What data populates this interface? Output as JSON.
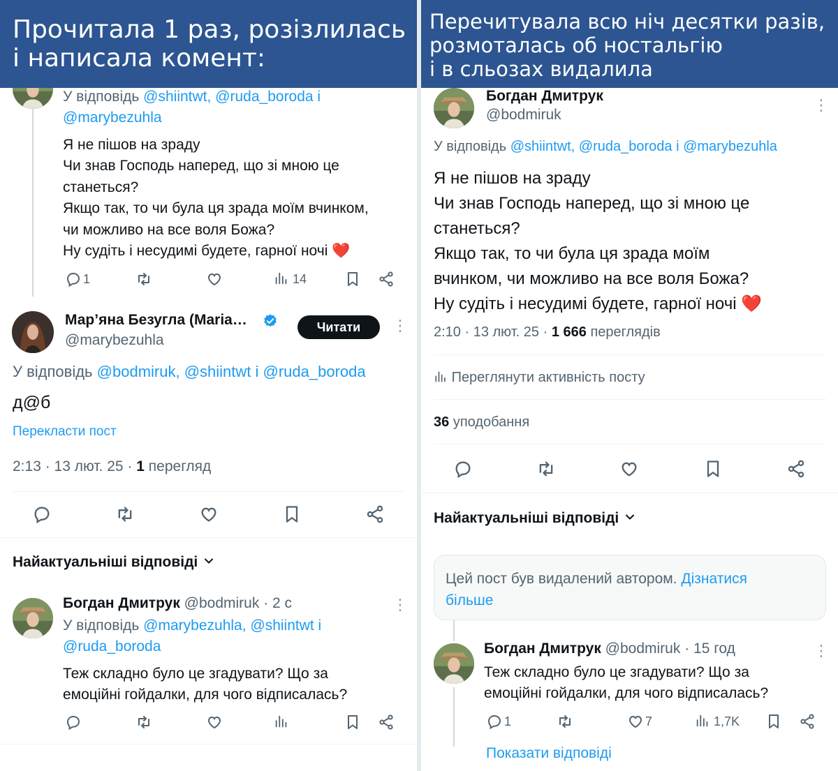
{
  "left": {
    "banner": [
      "Прочитала 1 раз, розізлилась",
      "і написала комент:"
    ],
    "tweet1": {
      "reply_to_line1_prefix": "У відповідь",
      "reply_to_line1_links": "@shiintwt, @ruda_boroda і",
      "reply_to_line2": "@marybezuhla",
      "text": [
        "Я не пішов на зраду",
        "Чи знав Господь наперед, що зі мною це",
        "станеться?",
        "Якщо так, то чи була ця зрада моїм вчинком,",
        "чи можливо на все воля Божа?",
        "Ну судіть і несудимі будете, гарної ночі"
      ],
      "heart_emoji": "❤️",
      "replies": "1",
      "views": "14"
    },
    "tweet2": {
      "name": "Мар’яна Безугла (Maria…",
      "handle": "@marybezuhla",
      "follow_label": "Читати",
      "reply_prefix": "У відповідь",
      "reply_links": "@bodmiruk, @shiintwt і @ruda_boroda",
      "text": "д@б",
      "translate": "Перекласти пост",
      "time": "2:13 · 13 лют. 25 ·",
      "views_num": "1",
      "views_label": "перегляд"
    },
    "replies_header": "Найактуальніші відповіді",
    "tweet3": {
      "name": "Богдан Дмитрук",
      "handle": "@bodmiruk · 2 с",
      "reply_prefix": "У відповідь",
      "reply_links_line1": "@marybezuhla, @shiintwt і",
      "reply_links_line2": "@ruda_boroda",
      "text": [
        "Теж складно було це згадувати? Що за",
        "емоційні гойдалки, для чого відписалась?"
      ]
    }
  },
  "right": {
    "banner": [
      "Перечитувала всю ніч десятки разів,",
      "розмоталась об ностальгію",
      "і в сльозах видалила"
    ],
    "main": {
      "name": "Богдан Дмитрук",
      "handle": "@bodmiruk",
      "reply_prefix": "У відповідь",
      "reply_links": "@shiintwt, @ruda_boroda і @marybezuhla",
      "text": [
        "Я не пішов на зраду",
        "Чи знав Господь наперед, що зі мною це",
        "станеться?",
        "Якщо так, то чи була ця зрада моїм",
        "вчинком, чи можливо на все воля Божа?",
        "Ну судіть і несудимі будете, гарної ночі"
      ],
      "heart_emoji": "❤️",
      "time": "2:10 · 13 лют. 25 ·",
      "views_num": "1 666",
      "views_label": "переглядів",
      "activity": "Переглянути активність посту",
      "likes_num": "36",
      "likes_label": "уподобання"
    },
    "replies_header": "Найактуальніші відповіді",
    "deleted": {
      "text": "Цей пост був видалений автором.",
      "link_line1": "Дізнатися",
      "link_line2": "більше"
    },
    "reply": {
      "name": "Богдан Дмитрук",
      "handle": "@bodmiruk · 15 год",
      "text": [
        "Теж складно було це згадувати? Що за",
        "емоційні гойдалки, для чого відписалась?"
      ],
      "replies": "1",
      "likes": "7",
      "views": "1,7K",
      "show_replies": "Показати відповіді"
    }
  },
  "icons": {
    "reply": "reply-icon",
    "retweet": "retweet-icon",
    "like": "heart-icon",
    "views": "views-icon",
    "bookmark": "bookmark-icon",
    "share": "share-icon",
    "verified": "verified-badge-icon",
    "more": "more-icon",
    "chevron": "chevron-down-icon"
  },
  "colors": {
    "banner": "#2c5591",
    "link": "#1d9bf0",
    "muted": "#536471",
    "heart": "#e0245e"
  }
}
